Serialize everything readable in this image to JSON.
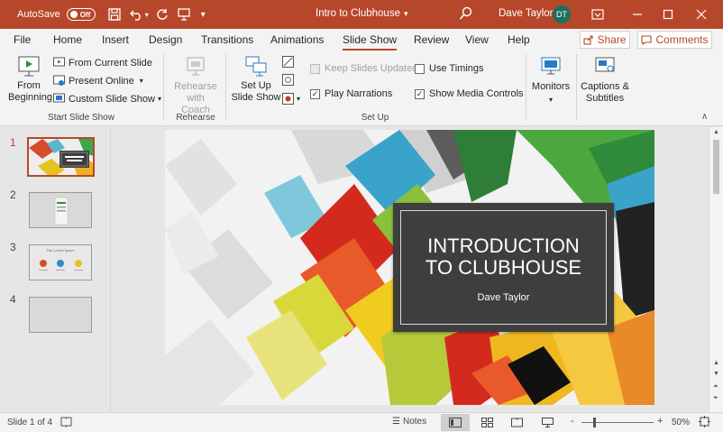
{
  "titlebar": {
    "autosave_label": "AutoSave",
    "autosave_state": "Off",
    "doc_title": "Intro to Clubhouse",
    "user_name": "Dave Taylor",
    "user_initials": "DT",
    "accent": "#b7472a"
  },
  "tabs": [
    "File",
    "Home",
    "Insert",
    "Design",
    "Transitions",
    "Animations",
    "Slide Show",
    "Review",
    "View",
    "Help"
  ],
  "active_tab": "Slide Show",
  "share_label": "Share",
  "comments_label": "Comments",
  "ribbon": {
    "from_beginning": "From Beginning",
    "from_current": "From Current Slide",
    "present_online": "Present Online",
    "custom_slide_show": "Custom Slide Show",
    "group_start": "Start Slide Show",
    "rehearse_coach": "Rehearse with Coach",
    "group_rehearse": "Rehearse",
    "setup_slide_show": "Set Up Slide Show",
    "keep_updated": "Keep Slides Updated",
    "use_timings": "Use Timings",
    "play_narrations": "Play Narrations",
    "show_media_controls": "Show Media Controls",
    "group_setup": "Set Up",
    "monitors": "Monitors",
    "captions_subtitles": "Captions & Subtitles"
  },
  "thumbnails": [
    {
      "number": "1",
      "active": true
    },
    {
      "number": "2",
      "active": false
    },
    {
      "number": "3",
      "active": false,
      "caption": "The Lorem Ipsum"
    },
    {
      "number": "4",
      "active": false
    }
  ],
  "slide": {
    "title_line1": "INTRODUCTION",
    "title_line2": "TO CLUBHOUSE",
    "subtitle": "Dave Taylor"
  },
  "status": {
    "slide_counter": "Slide 1 of 4",
    "notes_label": "Notes",
    "zoom_minus": "-",
    "zoom_plus": "+",
    "zoom_level": "50%"
  }
}
